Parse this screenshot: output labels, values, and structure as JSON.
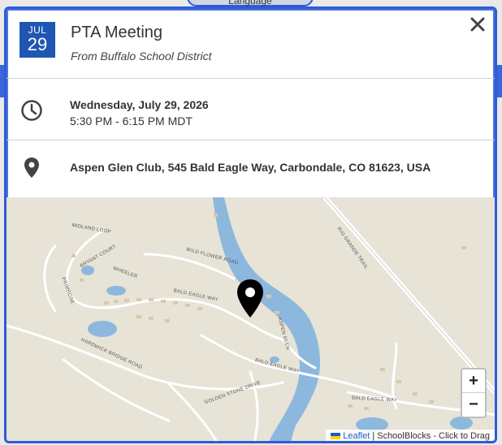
{
  "background": {
    "tab_label": "Language"
  },
  "event": {
    "month": "JUL",
    "day": "29",
    "title": "PTA Meeting",
    "source": "From Buffalo School District",
    "date": "Wednesday, July 29, 2026",
    "time": "5:30 PM - 6:15 PM MDT",
    "location": "Aspen Glen Club, 545 Bald Eagle Way, Carbondale, CO 81623, USA"
  },
  "icons": {
    "close": "close-icon",
    "clock": "clock-icon",
    "location": "map-pin-icon",
    "marker": "map-marker-icon"
  },
  "map": {
    "zoom_in_label": "+",
    "zoom_out_label": "−",
    "attribution_leaflet": "Leaflet",
    "attribution_rest": "| SchoolBlocks - Click to Drag",
    "road_labels": {
      "midland_loop": "MIDLAND LOOP",
      "bryant_court": "BRYANT COURT",
      "wheeler": "WHEELER",
      "primrose": "PRIMROSE",
      "wild_flower": "WILD FLOWER ROAD",
      "bald_eagle_1": "BALD EAGLE WAY",
      "bald_eagle_2": "BALD EAGLE WAY",
      "bald_eagle_3": "BALD EAGLE WAY",
      "hardwick": "HARDWICK BRIDGE ROAD",
      "golden_stone": "GOLDEN STONE DRIVE",
      "rio_grande": "RIO GRANDE TRAIL",
      "aspen_glen": "ASPEN GLEN"
    }
  },
  "colors": {
    "brand_blue": "#1f56b3",
    "modal_border": "#2f5bd6",
    "water": "#8db8dd",
    "land": "#e7e3d7"
  }
}
